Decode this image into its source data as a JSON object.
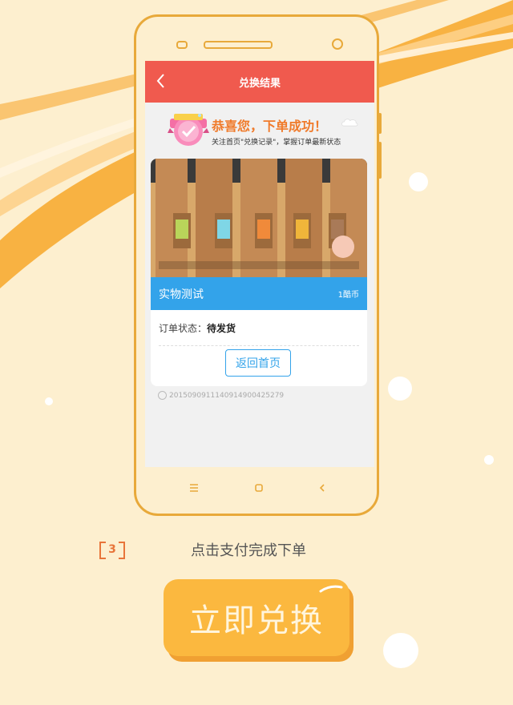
{
  "nav": {
    "title": "兑换结果"
  },
  "success": {
    "title": "恭喜您，下单成功！",
    "subtitle": "关注首页\"兑换记录\"，掌握订单最新状态"
  },
  "product": {
    "name": "实物测试",
    "price": "1酷币",
    "status_label": "订单状态：",
    "status_value": "待发货",
    "back_home_label": "返回首页",
    "order_id": "2015090911140914900425279"
  },
  "step": {
    "number": "3",
    "text": "点击支付完成下单"
  },
  "redeem_button": {
    "label": "立即兑换"
  },
  "colors": {
    "page_bg": "#fdefcf",
    "accent_orange": "#f8ae3a",
    "navbar_red": "#f05a4e",
    "product_blue": "#33a3ea",
    "success_orange": "#f07a2a"
  }
}
